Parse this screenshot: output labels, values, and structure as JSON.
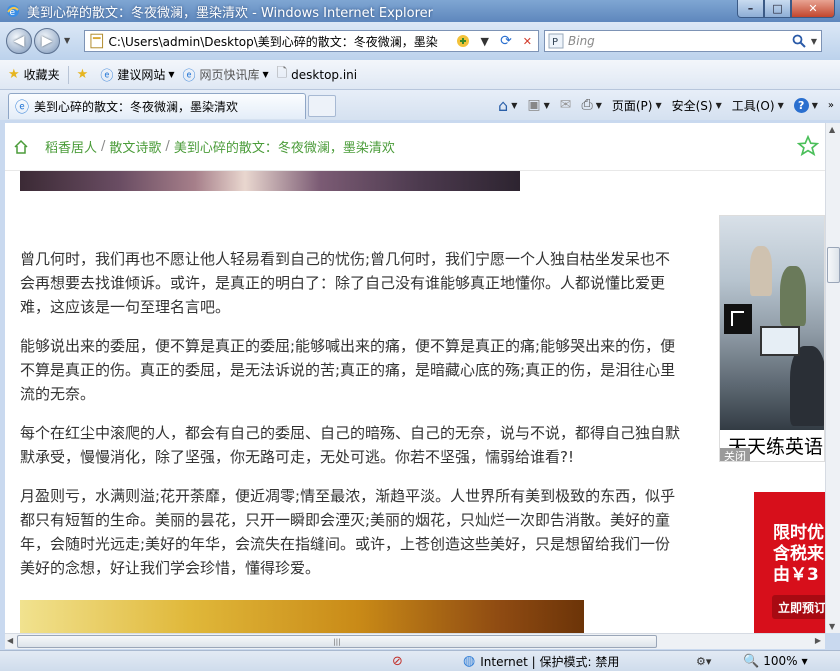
{
  "window": {
    "title": "美到心碎的散文：冬夜微澜，墨染清欢 - Windows Internet Explorer",
    "minimize": "–",
    "maximize": "□",
    "close": "✕"
  },
  "address": {
    "url": "C:\\Users\\admin\\Desktop\\美到心碎的散文：冬夜微澜，墨染",
    "search_placeholder": "Bing"
  },
  "favorites": {
    "favorites_label": "收藏夹",
    "suggested_sites": "建议网站",
    "web_slice": "网页快讯库",
    "desktop_ini": "desktop.ini"
  },
  "tab": {
    "label": "美到心碎的散文：冬夜微澜，墨染清欢"
  },
  "commands": {
    "page": "页面(P)",
    "safety": "安全(S)",
    "tools": "工具(O)"
  },
  "breadcrumb": {
    "items": [
      "稻香居人",
      "散文诗歌",
      "美到心碎的散文：冬夜微澜，墨染清欢"
    ],
    "separator": "/"
  },
  "article": {
    "paragraphs": [
      "曾几何时，我们再也不愿让他人轻易看到自己的忧伤;曾几何时，我们宁愿一个人独自枯坐发呆也不会再想要去找谁倾诉。或许，是真正的明白了：除了自己没有谁能够真正地懂你。人都说懂比爱更难，这应该是一句至理名言吧。",
      "能够说出来的委屈，便不算是真正的委屈;能够喊出来的痛，便不算是真正的痛;能够哭出来的伤，便不算是真正的伤。真正的委屈，是无法诉说的苦;真正的痛，是暗藏心底的殇;真正的伤，是泪往心里流的无奈。",
      "每个在红尘中滚爬的人，都会有自己的委屈、自己的暗殇、自己的无奈，说与不说，都得自己独自默默承受，慢慢消化，除了坚强，你无路可走，无处可逃。你若不坚强，懦弱给谁看?!",
      "月盈则亏，水满则溢;花开荼靡，便近凋零;情至最浓，渐趋平淡。人世界所有美到极致的东西，似乎都只有短暂的生命。美丽的昙花，只开一瞬即会湮灭;美丽的烟花，只灿烂一次即告消散。美好的童年，会随时光远走;美好的年华，会流失在指缝间。或许，上苍创造这些美好，只是想留给我们一份美好的念想，好让我们学会珍惜，懂得珍爱。"
    ]
  },
  "ads": {
    "ad1_caption": "天天练英语",
    "ad1_close": "关闭",
    "ad2_lines": [
      "限时优",
      "含税来",
      "由￥3"
    ],
    "ad2_button": "立即预订"
  },
  "status": {
    "zone": "Internet | 保护模式: 禁用",
    "zoom": "100%"
  },
  "colors": {
    "breadcrumb_green": "#4b9c3a",
    "ad_red": "#d70f1b"
  }
}
